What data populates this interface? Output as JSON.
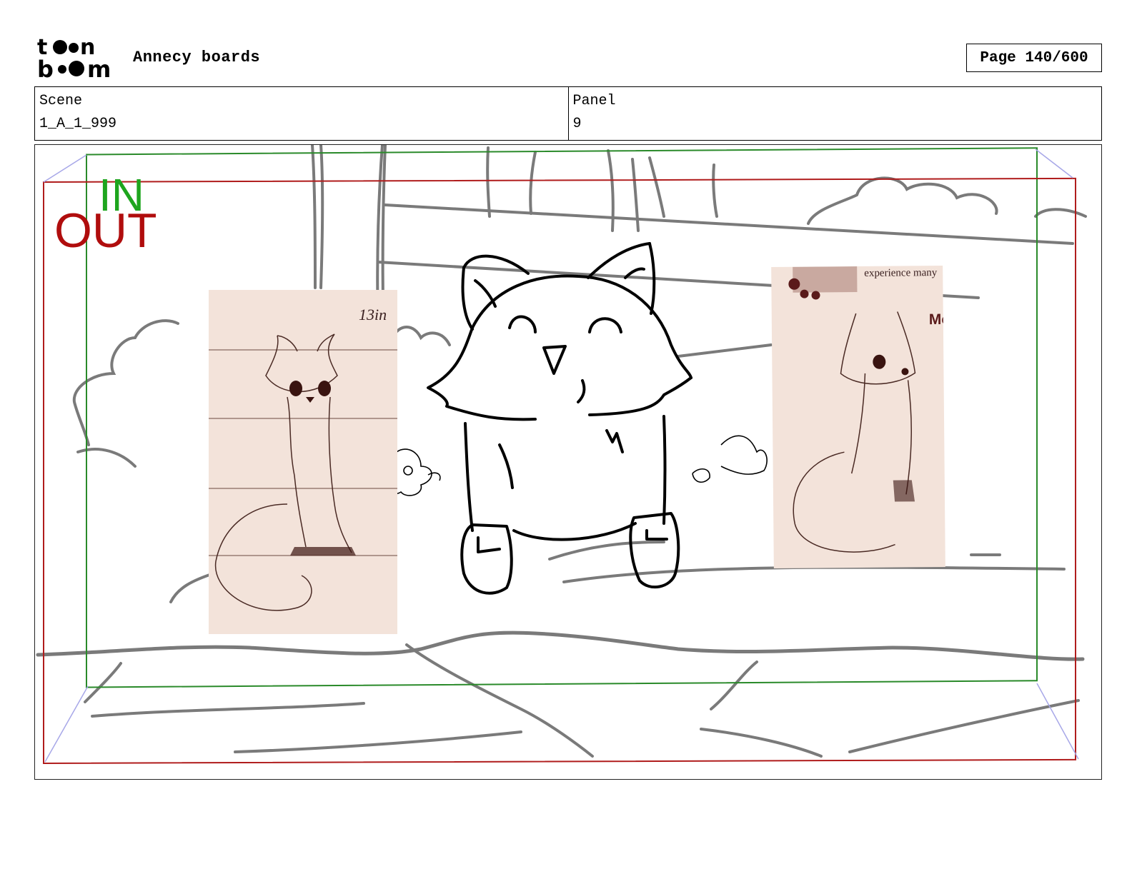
{
  "header": {
    "logo_text": "toon boom",
    "title": "Annecy boards",
    "page_label": "Page 140/600"
  },
  "info": {
    "scene_label": "Scene",
    "scene_value": "1_A_1_999",
    "panel_label": "Panel",
    "panel_value": "9"
  },
  "panel": {
    "in_label": "IN",
    "out_label": "OUT",
    "in_color": "#1ea51e",
    "out_color": "#b00d0d",
    "left_reference": {
      "note": "13in"
    },
    "right_reference": {
      "caption": "experience many",
      "partial_text": "Mo"
    }
  }
}
